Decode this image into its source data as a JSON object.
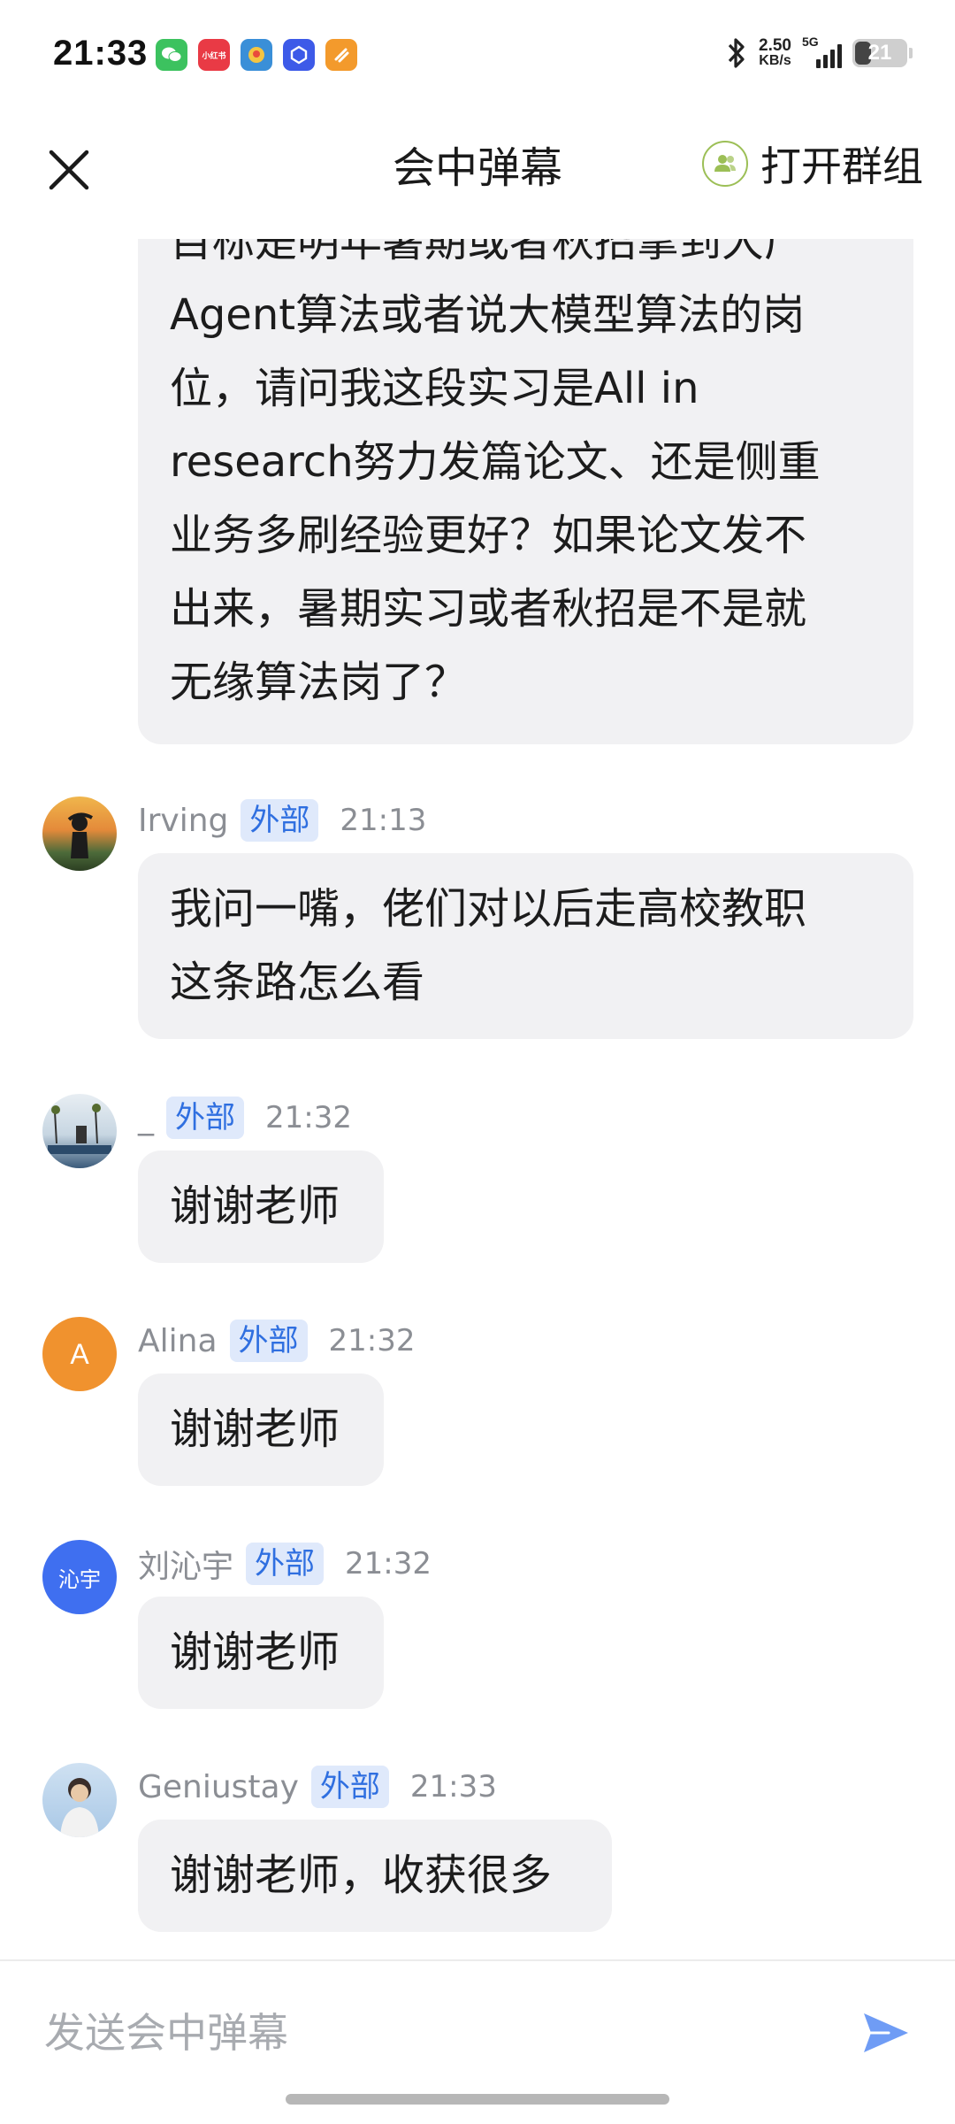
{
  "status_bar": {
    "time": "21:33",
    "app_icons": [
      {
        "name": "wechat-icon",
        "color": "#3cc25f",
        "label": ""
      },
      {
        "name": "xiaohongshu-icon",
        "color": "#e93a45",
        "label": "小红书"
      },
      {
        "name": "map-app-icon",
        "color": "#3a8fd8",
        "label": ""
      },
      {
        "name": "cube-app-icon",
        "color": "#3d5ae8",
        "label": ""
      },
      {
        "name": "orange-app-icon",
        "color": "#f39a2c",
        "label": ""
      }
    ],
    "net_speed_value": "2.50",
    "net_speed_unit": "KB/s",
    "network_type": "5G",
    "battery_level": "21"
  },
  "header": {
    "title": "会中弹幕",
    "open_group_label": "打开群组"
  },
  "first_message": {
    "lines": [
      "目标是明年暑期或者秋招拿到大厂",
      "Agent算法或者说大模型算法的岗",
      "位，请问我这段实习是All in",
      "research努力发篇论文、还是侧重",
      "业务多刷经验更好？如果论文发不",
      "出来，暑期实习或者秋招是不是就",
      "无缘算法岗了？"
    ]
  },
  "badge_label": "外部",
  "messages": [
    {
      "sender": "Irving",
      "time": "21:13",
      "avatar_text": "",
      "avatar_color": "#d9a04a",
      "lines": [
        "我问一嘴，佬们对以后走高校教职",
        "这条路怎么看"
      ]
    },
    {
      "sender": "_",
      "time": "21:32",
      "avatar_text": "",
      "avatar_color": "#9fb7cc",
      "lines": [
        "谢谢老师"
      ]
    },
    {
      "sender": "Alina",
      "time": "21:32",
      "avatar_text": "A",
      "avatar_color": "#f0922e",
      "lines": [
        "谢谢老师"
      ]
    },
    {
      "sender": "刘沁宇",
      "time": "21:32",
      "avatar_text": "沁宇",
      "avatar_color": "#3f6ff0",
      "lines": [
        "谢谢老师"
      ]
    },
    {
      "sender": "Geniustay",
      "time": "21:33",
      "avatar_text": "",
      "avatar_color": "#a9c8e6",
      "lines": [
        "谢谢老师，收获很多"
      ]
    }
  ],
  "input": {
    "placeholder": "发送会中弹幕",
    "value": ""
  },
  "colors": {
    "accent_blue": "#2f6fe0",
    "send_icon": "#6f9cf5",
    "bubble_bg": "#f1f1f3",
    "badge_bg": "#dfe9fb",
    "group_icon_green": "#9cbf56"
  }
}
